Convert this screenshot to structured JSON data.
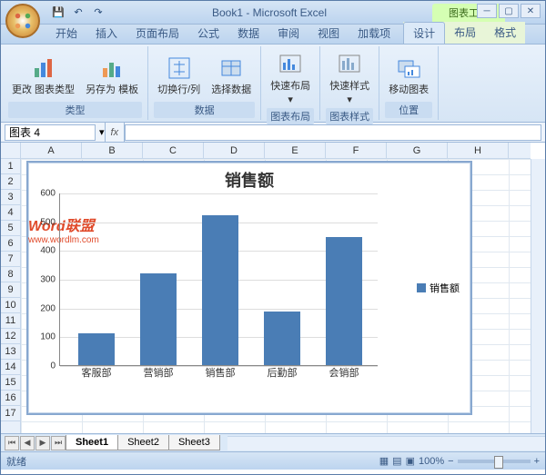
{
  "app": {
    "title": "Book1 - Microsoft Excel",
    "context_title": "图表工具"
  },
  "qat": {
    "save": "💾",
    "undo": "↶",
    "redo": "↷"
  },
  "tabs": {
    "items": [
      "开始",
      "插入",
      "页面布局",
      "公式",
      "数据",
      "审阅",
      "视图",
      "加载项"
    ],
    "ctx": [
      "设计",
      "布局",
      "格式"
    ],
    "active": "设计"
  },
  "ribbon": {
    "g1": {
      "label": "类型",
      "b1": "更改\n图表类型",
      "b2": "另存为\n模板"
    },
    "g2": {
      "label": "数据",
      "b1": "切换行/列",
      "b2": "选择数据"
    },
    "g3": {
      "label": "图表布局",
      "b1": "快速布局"
    },
    "g4": {
      "label": "图表样式",
      "b1": "快速样式"
    },
    "g5": {
      "label": "位置",
      "b1": "移动图表"
    }
  },
  "namebox": "图表 4",
  "columns": [
    "A",
    "B",
    "C",
    "D",
    "E",
    "F",
    "G",
    "H"
  ],
  "rows": [
    "1",
    "2",
    "3",
    "4",
    "5",
    "6",
    "7",
    "8",
    "9",
    "10",
    "11",
    "12",
    "13",
    "14",
    "15",
    "16",
    "17"
  ],
  "chart_data": {
    "type": "bar",
    "title": "销售额",
    "categories": [
      "客服部",
      "营销部",
      "销售部",
      "后勤部",
      "会销部"
    ],
    "values": [
      110,
      320,
      520,
      185,
      445
    ],
    "series_name": "销售额",
    "ylim": [
      0,
      600
    ],
    "yticks": [
      0,
      100,
      200,
      300,
      400,
      500,
      600
    ]
  },
  "watermark": {
    "text": "Word联盟",
    "url": "www.wordlm.com"
  },
  "sheets": {
    "items": [
      "Sheet1",
      "Sheet2",
      "Sheet3"
    ],
    "active": 0
  },
  "status": {
    "ready": "就绪",
    "zoom": "100%"
  }
}
